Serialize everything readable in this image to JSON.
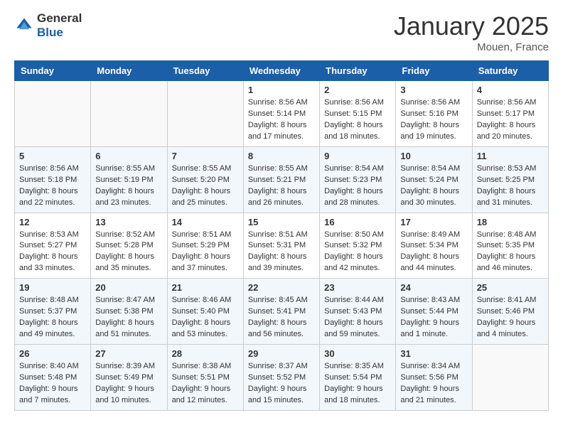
{
  "logo": {
    "general": "General",
    "blue": "Blue"
  },
  "header": {
    "month": "January 2025",
    "location": "Mouen, France"
  },
  "weekdays": [
    "Sunday",
    "Monday",
    "Tuesday",
    "Wednesday",
    "Thursday",
    "Friday",
    "Saturday"
  ],
  "weeks": [
    [
      {
        "day": "",
        "content": ""
      },
      {
        "day": "",
        "content": ""
      },
      {
        "day": "",
        "content": ""
      },
      {
        "day": "1",
        "content": "Sunrise: 8:56 AM\nSunset: 5:14 PM\nDaylight: 8 hours\nand 17 minutes."
      },
      {
        "day": "2",
        "content": "Sunrise: 8:56 AM\nSunset: 5:15 PM\nDaylight: 8 hours\nand 18 minutes."
      },
      {
        "day": "3",
        "content": "Sunrise: 8:56 AM\nSunset: 5:16 PM\nDaylight: 8 hours\nand 19 minutes."
      },
      {
        "day": "4",
        "content": "Sunrise: 8:56 AM\nSunset: 5:17 PM\nDaylight: 8 hours\nand 20 minutes."
      }
    ],
    [
      {
        "day": "5",
        "content": "Sunrise: 8:56 AM\nSunset: 5:18 PM\nDaylight: 8 hours\nand 22 minutes."
      },
      {
        "day": "6",
        "content": "Sunrise: 8:55 AM\nSunset: 5:19 PM\nDaylight: 8 hours\nand 23 minutes."
      },
      {
        "day": "7",
        "content": "Sunrise: 8:55 AM\nSunset: 5:20 PM\nDaylight: 8 hours\nand 25 minutes."
      },
      {
        "day": "8",
        "content": "Sunrise: 8:55 AM\nSunset: 5:21 PM\nDaylight: 8 hours\nand 26 minutes."
      },
      {
        "day": "9",
        "content": "Sunrise: 8:54 AM\nSunset: 5:23 PM\nDaylight: 8 hours\nand 28 minutes."
      },
      {
        "day": "10",
        "content": "Sunrise: 8:54 AM\nSunset: 5:24 PM\nDaylight: 8 hours\nand 30 minutes."
      },
      {
        "day": "11",
        "content": "Sunrise: 8:53 AM\nSunset: 5:25 PM\nDaylight: 8 hours\nand 31 minutes."
      }
    ],
    [
      {
        "day": "12",
        "content": "Sunrise: 8:53 AM\nSunset: 5:27 PM\nDaylight: 8 hours\nand 33 minutes."
      },
      {
        "day": "13",
        "content": "Sunrise: 8:52 AM\nSunset: 5:28 PM\nDaylight: 8 hours\nand 35 minutes."
      },
      {
        "day": "14",
        "content": "Sunrise: 8:51 AM\nSunset: 5:29 PM\nDaylight: 8 hours\nand 37 minutes."
      },
      {
        "day": "15",
        "content": "Sunrise: 8:51 AM\nSunset: 5:31 PM\nDaylight: 8 hours\nand 39 minutes."
      },
      {
        "day": "16",
        "content": "Sunrise: 8:50 AM\nSunset: 5:32 PM\nDaylight: 8 hours\nand 42 minutes."
      },
      {
        "day": "17",
        "content": "Sunrise: 8:49 AM\nSunset: 5:34 PM\nDaylight: 8 hours\nand 44 minutes."
      },
      {
        "day": "18",
        "content": "Sunrise: 8:48 AM\nSunset: 5:35 PM\nDaylight: 8 hours\nand 46 minutes."
      }
    ],
    [
      {
        "day": "19",
        "content": "Sunrise: 8:48 AM\nSunset: 5:37 PM\nDaylight: 8 hours\nand 49 minutes."
      },
      {
        "day": "20",
        "content": "Sunrise: 8:47 AM\nSunset: 5:38 PM\nDaylight: 8 hours\nand 51 minutes."
      },
      {
        "day": "21",
        "content": "Sunrise: 8:46 AM\nSunset: 5:40 PM\nDaylight: 8 hours\nand 53 minutes."
      },
      {
        "day": "22",
        "content": "Sunrise: 8:45 AM\nSunset: 5:41 PM\nDaylight: 8 hours\nand 56 minutes."
      },
      {
        "day": "23",
        "content": "Sunrise: 8:44 AM\nSunset: 5:43 PM\nDaylight: 8 hours\nand 59 minutes."
      },
      {
        "day": "24",
        "content": "Sunrise: 8:43 AM\nSunset: 5:44 PM\nDaylight: 9 hours\nand 1 minute."
      },
      {
        "day": "25",
        "content": "Sunrise: 8:41 AM\nSunset: 5:46 PM\nDaylight: 9 hours\nand 4 minutes."
      }
    ],
    [
      {
        "day": "26",
        "content": "Sunrise: 8:40 AM\nSunset: 5:48 PM\nDaylight: 9 hours\nand 7 minutes."
      },
      {
        "day": "27",
        "content": "Sunrise: 8:39 AM\nSunset: 5:49 PM\nDaylight: 9 hours\nand 10 minutes."
      },
      {
        "day": "28",
        "content": "Sunrise: 8:38 AM\nSunset: 5:51 PM\nDaylight: 9 hours\nand 12 minutes."
      },
      {
        "day": "29",
        "content": "Sunrise: 8:37 AM\nSunset: 5:52 PM\nDaylight: 9 hours\nand 15 minutes."
      },
      {
        "day": "30",
        "content": "Sunrise: 8:35 AM\nSunset: 5:54 PM\nDaylight: 9 hours\nand 18 minutes."
      },
      {
        "day": "31",
        "content": "Sunrise: 8:34 AM\nSunset: 5:56 PM\nDaylight: 9 hours\nand 21 minutes."
      },
      {
        "day": "",
        "content": ""
      }
    ]
  ]
}
